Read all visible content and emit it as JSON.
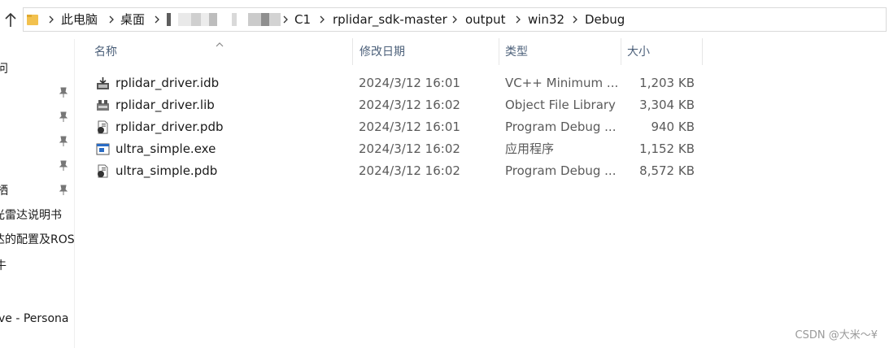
{
  "breadcrumb": {
    "items": [
      "此电脑",
      "桌面",
      "C1",
      "rplidar_sdk-master",
      "output",
      "win32",
      "Debug"
    ]
  },
  "sidebar": {
    "items": [
      "问",
      "栖",
      "光雷达说明书",
      "达的配置及ROS",
      "牛",
      "ve - Persona"
    ]
  },
  "columns": {
    "name": "名称",
    "date": "修改日期",
    "type": "类型",
    "size": "大小"
  },
  "files": [
    {
      "name": "rplidar_driver.idb",
      "date": "2024/3/12 16:01",
      "type": "VC++ Minimum ...",
      "size": "1,203 KB",
      "icon": "idb-file-icon"
    },
    {
      "name": "rplidar_driver.lib",
      "date": "2024/3/12 16:02",
      "type": "Object File Library",
      "size": "3,304 KB",
      "icon": "lib-file-icon"
    },
    {
      "name": "rplidar_driver.pdb",
      "date": "2024/3/12 16:01",
      "type": "Program Debug ...",
      "size": "940 KB",
      "icon": "pdb-file-icon"
    },
    {
      "name": "ultra_simple.exe",
      "date": "2024/3/12 16:02",
      "type": "应用程序",
      "size": "1,152 KB",
      "icon": "exe-file-icon"
    },
    {
      "name": "ultra_simple.pdb",
      "date": "2024/3/12 16:02",
      "type": "Program Debug ...",
      "size": "8,572 KB",
      "icon": "pdb-file-icon"
    }
  ],
  "watermark": "CSDN @大米～¥",
  "colors": {
    "folder": "#f2c14e",
    "header_text": "#4c607a",
    "secondary_text": "#5a5a5a",
    "exe_accent": "#2b6cc4"
  }
}
